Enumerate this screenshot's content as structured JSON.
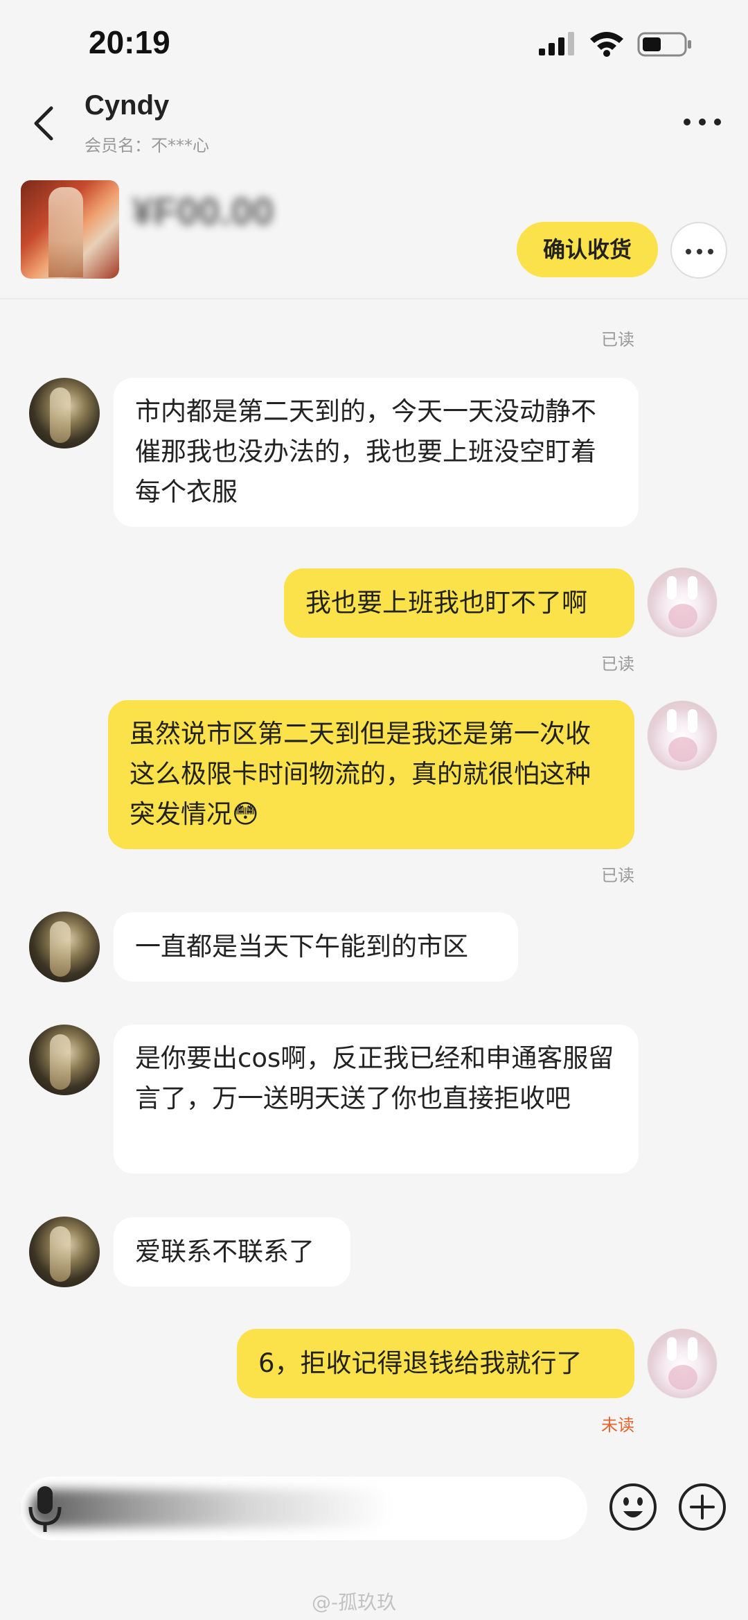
{
  "status_bar": {
    "time": "20:19",
    "signal_icon": "signal-icon",
    "wifi_icon": "wifi-icon",
    "battery_icon": "battery-icon"
  },
  "header": {
    "contact_name": "Cyndy",
    "member_name": "会员名：不***心",
    "back_icon": "back-chevron-icon",
    "more_icon": "more-dots-icon"
  },
  "product": {
    "price": "¥F00.00",
    "confirm_label": "确认收货",
    "more_icon": "more-dots-icon"
  },
  "messages": [
    {
      "status": "已读"
    },
    {
      "from": "other",
      "text": "市内都是第二天到的，今天一天没动静不催那我也没办法的，我也要上班没空盯着每个衣服"
    },
    {
      "from": "me",
      "text": "我也要上班我也盯不了啊",
      "status": "已读"
    },
    {
      "from": "me",
      "text": "虽然说市区第二天到但是我还是第一次收这么极限卡时间物流的，真的就很怕这种突发情况😳",
      "status": "已读"
    },
    {
      "from": "other",
      "text": "一直都是当天下午能到的市区"
    },
    {
      "from": "other",
      "text": "是你要出cos啊，反正我已经和申通客服留言了，万一送明天送了你也直接拒收吧"
    },
    {
      "from": "other",
      "text": "爱联系不联系了"
    },
    {
      "from": "me",
      "text": "6，拒收记得退钱给我就行了",
      "status": "未读"
    }
  ],
  "input_bar": {
    "mic_icon": "microphone-icon",
    "emoji_icon": "emoji-icon",
    "plus_icon": "plus-icon"
  },
  "watermark": "@-孤玖玖",
  "colors": {
    "accent": "#fbe14a",
    "unread": "#e8622d",
    "background": "#f5f5f5"
  }
}
